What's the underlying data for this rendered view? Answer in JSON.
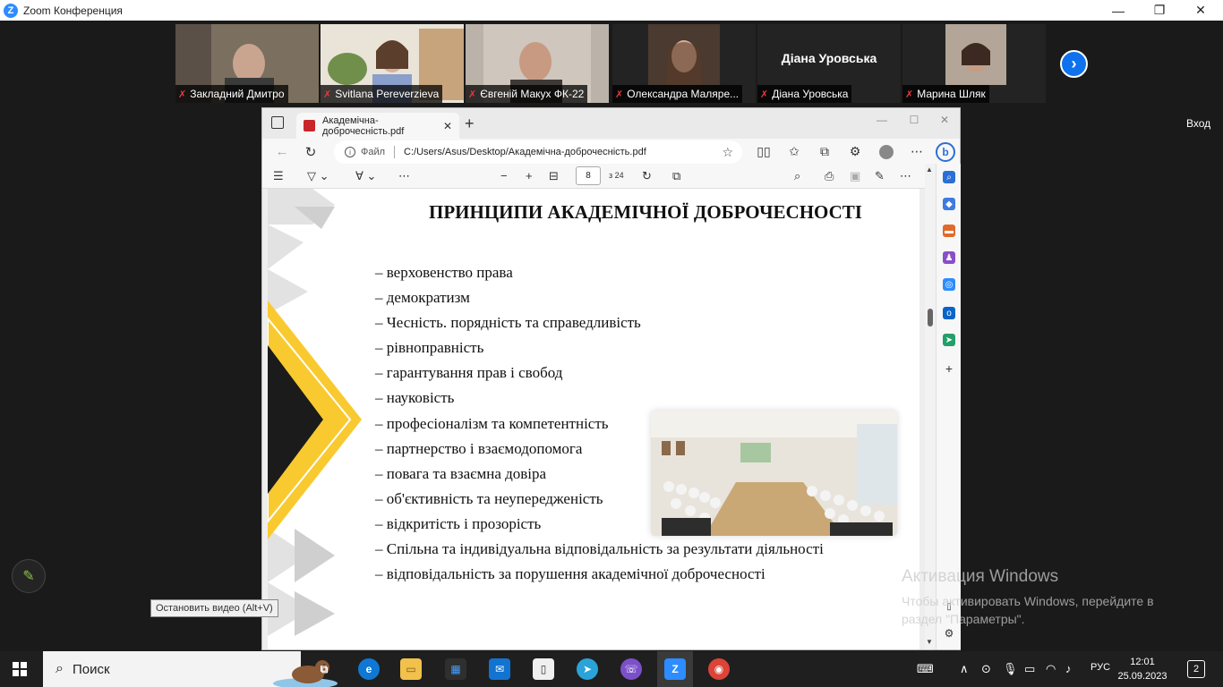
{
  "zoom": {
    "title": "Zoom Конференция",
    "minimize": "—",
    "maximize": "❐",
    "close": "✕",
    "enter_label": "Вход",
    "next_glyph": "›",
    "participants": [
      {
        "name": "Закладний Дмитро",
        "muted": true
      },
      {
        "name": "Svitlana Pereverzieva",
        "muted": true,
        "active": true
      },
      {
        "name": "Євгеній Макух ФК-22",
        "muted": true
      },
      {
        "name": "Олександра Маляре...",
        "muted": true
      },
      {
        "name": "Діана Уровська",
        "muted": true,
        "video_off_name": "Діана Уровська"
      },
      {
        "name": "Марина Шляк",
        "muted": true
      }
    ],
    "mic_glyph": "✗",
    "tooltip": "Остановить видео (Alt+V)",
    "pencil_glyph": "✎"
  },
  "browser": {
    "tab_title": "Академічна-доброчесність.pdf",
    "tab_close": "✕",
    "new_tab": "+",
    "address": {
      "scheme": "Файл",
      "url": "C:/Users/Asus/Desktop/Академічна-доброчесність.pdf"
    },
    "page_current": "8",
    "page_total": "з 24",
    "glyphs": {
      "back": "←",
      "refresh": "↻",
      "star": "☆",
      "more": "⋯",
      "list": "☰",
      "minus": "−",
      "plus": "+",
      "search": "⌕",
      "print": "⎙"
    }
  },
  "pdf_page": {
    "title": "ПРИНЦИПИ АКАДЕМІЧНОЇ ДОБРОЧЕСНОСТІ",
    "items": [
      "– верховенство права",
      "– демократизм",
      "– Чесність. порядність та справедливість",
      "– рівноправність",
      "– гарантування прав і свобод",
      "– науковість",
      "– професіоналізм та компетентність",
      "– партнерство і взаємодопомога",
      "– повага та взаємна довіра",
      "– об'єктивність та неупередженість",
      "– відкритість і прозорість",
      "– Спільна та індивідуальна відповідальність за результати діяльності",
      "– відповідальність за порушення академічної доброчесності"
    ],
    "colors": {
      "yellow": "#f9c930",
      "dark": "#1b1b1b",
      "grey": "#d9d9d9"
    }
  },
  "activation": {
    "title": "Активация Windows",
    "line1": "Чтобы активировать Windows, перейдите в",
    "line2": "раздел \"Параметры\"."
  },
  "taskbar": {
    "search_placeholder": "Поиск",
    "language": "РУС",
    "time": "12:01",
    "date": "25.09.2023",
    "notifications": "2",
    "apps": [
      {
        "name": "Task View",
        "glyph": "⧉"
      },
      {
        "name": "Edge",
        "glyph": "e"
      },
      {
        "name": "File Explorer",
        "glyph": "▭"
      },
      {
        "name": "Microsoft Store",
        "glyph": "▦"
      },
      {
        "name": "Mail",
        "glyph": "✉"
      },
      {
        "name": "Notepad",
        "glyph": "▯"
      },
      {
        "name": "Telegram",
        "glyph": "➤"
      },
      {
        "name": "Viber",
        "glyph": "☏"
      },
      {
        "name": "Zoom",
        "glyph": "Z"
      },
      {
        "name": "Chrome",
        "glyph": "◉"
      }
    ]
  }
}
